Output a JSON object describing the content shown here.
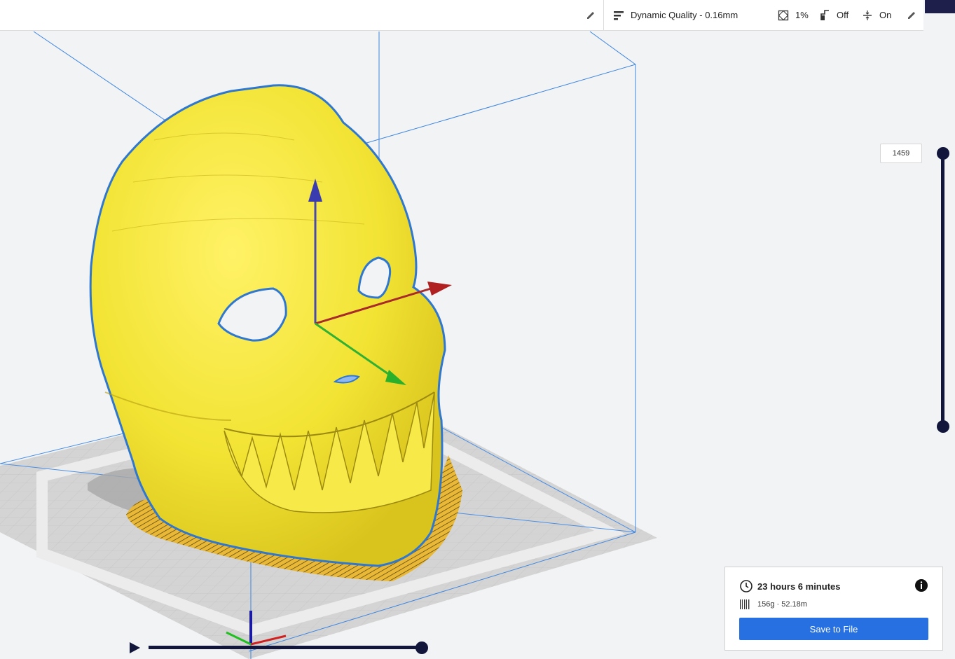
{
  "topbar": {
    "profile_name": "Dynamic Quality - 0.16mm",
    "infill_value": "1%",
    "support_value": "Off",
    "adhesion_value": "On"
  },
  "layer_view": {
    "current_layer": "1459"
  },
  "print_info": {
    "time": "23 hours 6 minutes",
    "material": "156g · 52.18m",
    "save_label": "Save to File"
  },
  "colors": {
    "model": "#f2e43a",
    "accent": "#2670e2",
    "slider": "#12163a"
  },
  "icons": [
    "edit-icon",
    "profile-icon",
    "infill-icon",
    "support-icon",
    "adhesion-icon",
    "play-icon",
    "clock-icon",
    "info-icon",
    "spool-icon"
  ]
}
